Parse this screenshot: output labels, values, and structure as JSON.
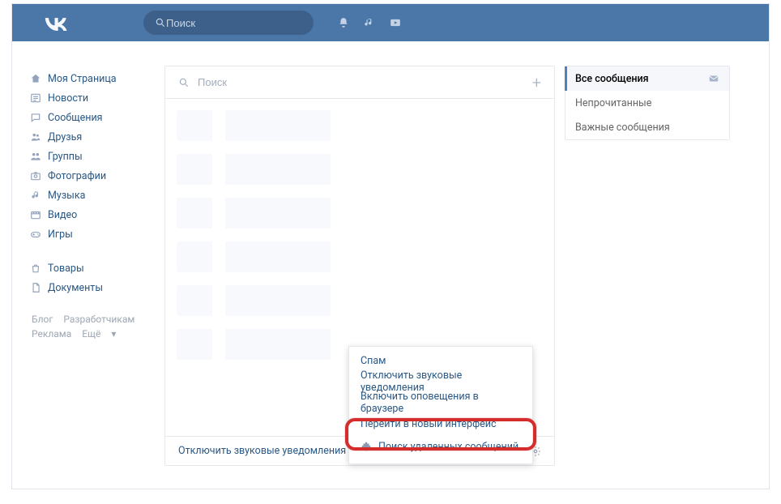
{
  "header": {
    "search_placeholder": "Поиск"
  },
  "sidebar": {
    "items": [
      "Моя Страница",
      "Новости",
      "Сообщения",
      "Друзья",
      "Группы",
      "Фотографии",
      "Музыка",
      "Видео",
      "Игры"
    ],
    "items2": [
      "Товары",
      "Документы"
    ],
    "footer": {
      "a": "Блог",
      "b": "Разработчикам",
      "c": "Реклама",
      "d": "Ещё"
    }
  },
  "messages": {
    "search_placeholder": "Поиск",
    "foot_label": "Отключить звуковые уведомления"
  },
  "right_tabs": {
    "a": "Все сообщения",
    "b": "Непрочитанные",
    "c": "Важные сообщения"
  },
  "popup": {
    "a": "Спам",
    "b": "Отключить звуковые уведомления",
    "c": "Включить оповещения в браузере",
    "d": "Перейти в новый интерфейс",
    "e": "Поиск удаленных сообщений"
  }
}
